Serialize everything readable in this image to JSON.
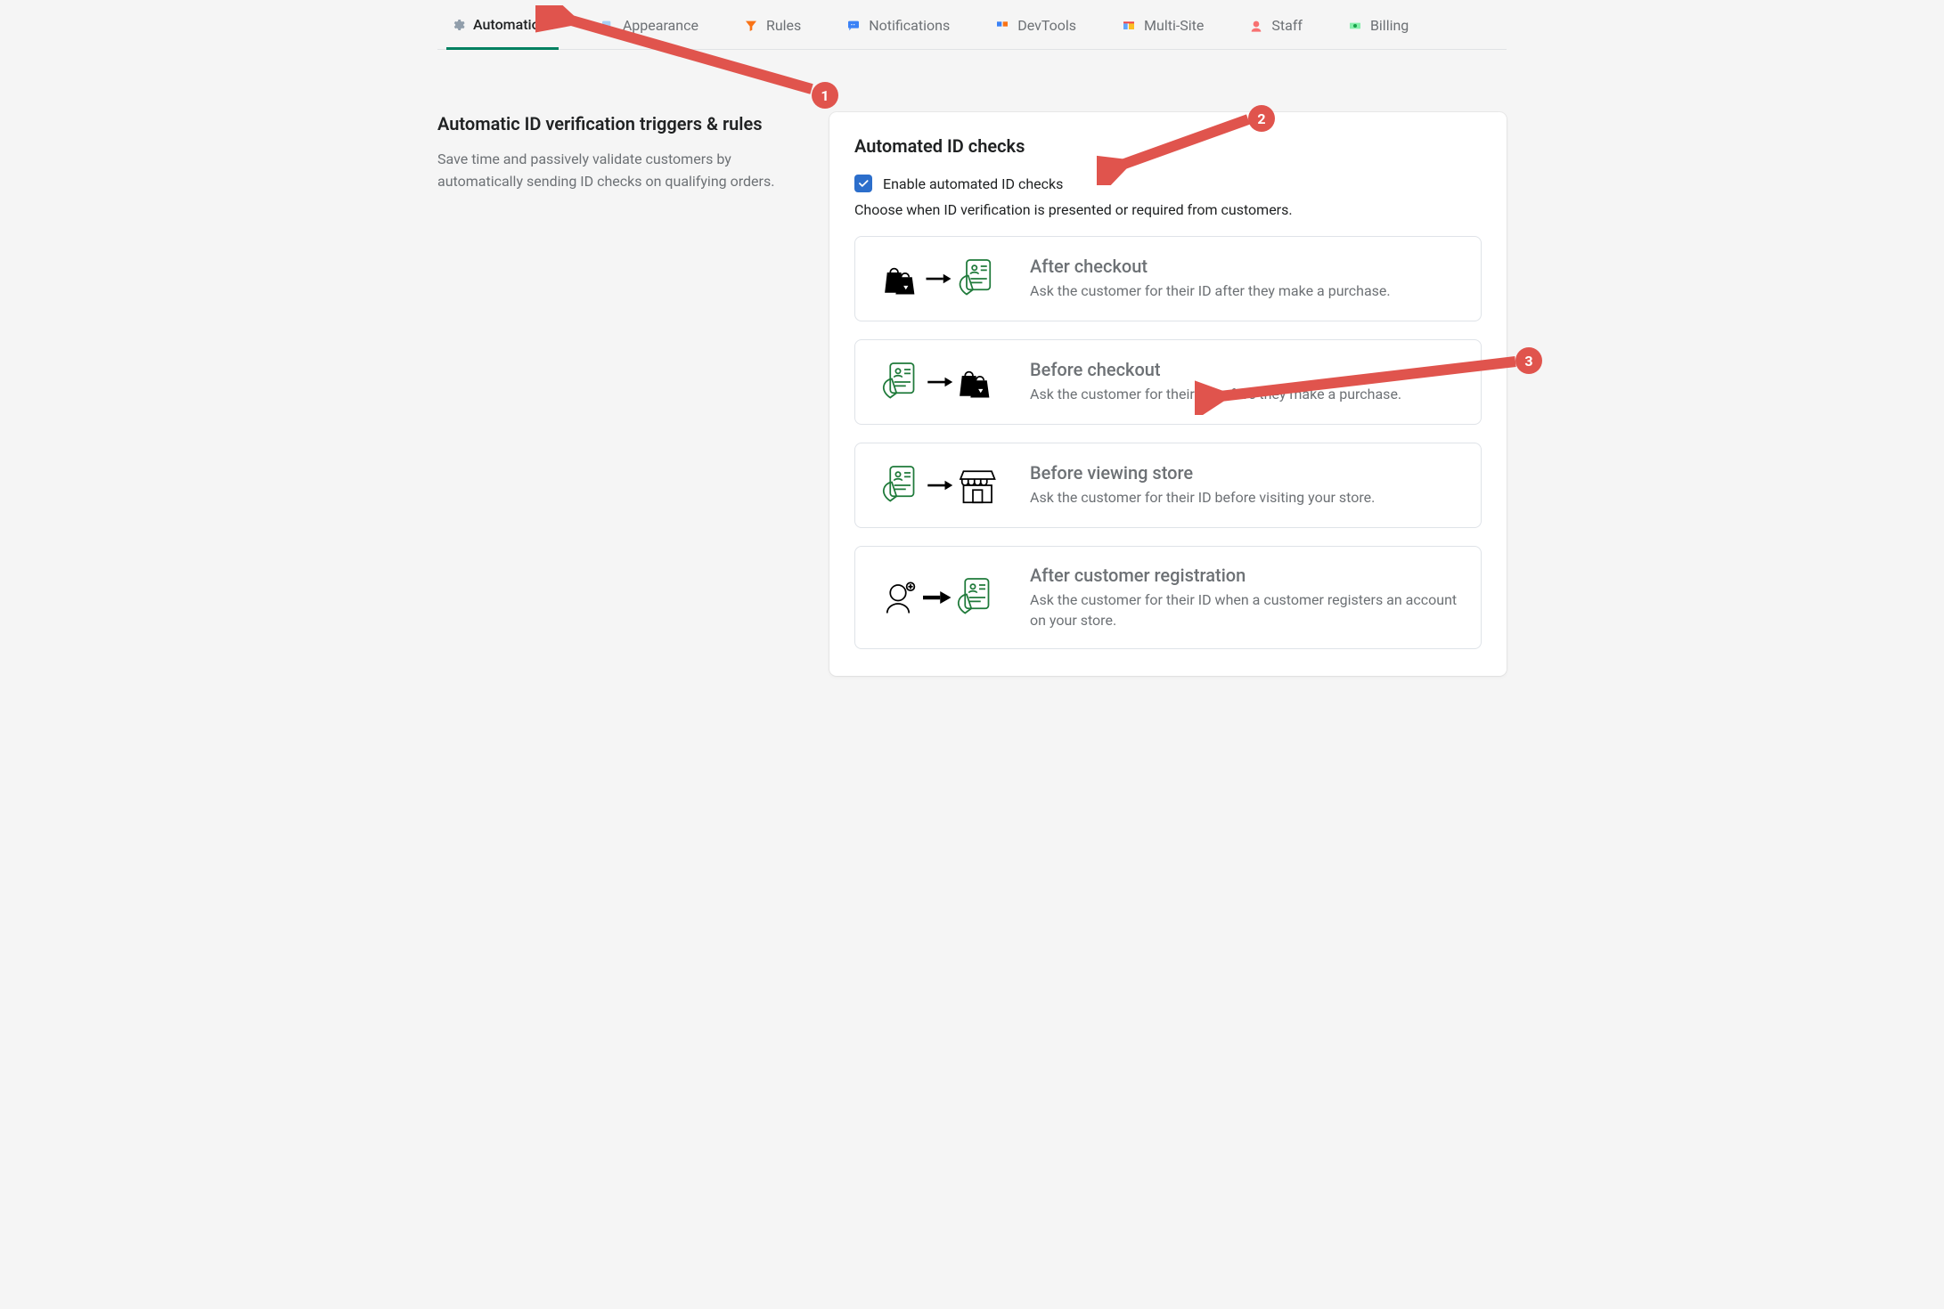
{
  "tabs": [
    {
      "label": "Automations"
    },
    {
      "label": "Appearance"
    },
    {
      "label": "Rules"
    },
    {
      "label": "Notifications"
    },
    {
      "label": "DevTools"
    },
    {
      "label": "Multi-Site"
    },
    {
      "label": "Staff"
    },
    {
      "label": "Billing"
    }
  ],
  "sidebar": {
    "title": "Automatic ID verification triggers & rules",
    "description": "Save time and passively validate customers by automatically sending ID checks on qualifying orders."
  },
  "card": {
    "title": "Automated ID checks",
    "enable_label": "Enable automated ID checks",
    "enable_checked": true,
    "help": "Choose when ID verification is presented or required from customers.",
    "options": [
      {
        "title": "After checkout",
        "desc": "Ask the customer for their ID after they make a purchase."
      },
      {
        "title": "Before checkout",
        "desc": "Ask the customer for their ID before they make a purchase."
      },
      {
        "title": "Before viewing store",
        "desc": "Ask the customer for their ID before visiting your store."
      },
      {
        "title": "After customer registration",
        "desc": "Ask the customer for their ID when a customer registers an account on your store."
      }
    ]
  },
  "annotations": {
    "b1": "1",
    "b2": "2",
    "b3": "3"
  }
}
